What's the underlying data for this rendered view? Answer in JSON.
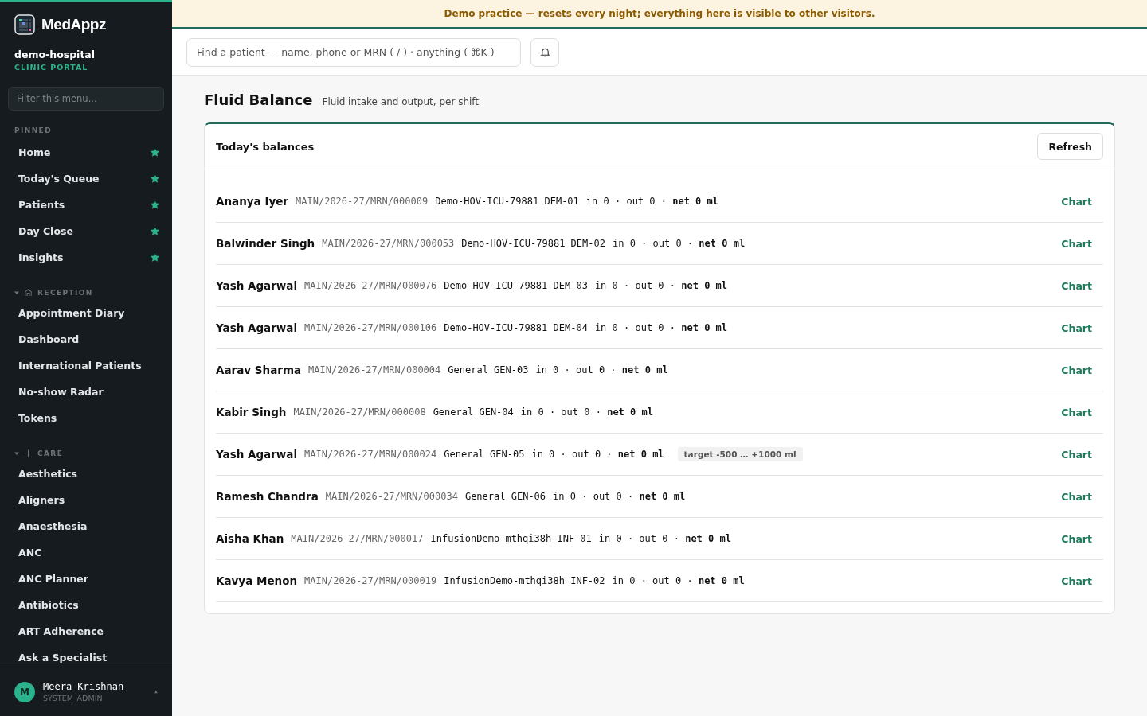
{
  "brand": {
    "name": "MedAppz",
    "org": "demo-hospital",
    "portal": "CLINIC PORTAL"
  },
  "sidebar": {
    "filter_placeholder": "Filter this menu...",
    "pinned": {
      "title": "PINNED",
      "items": [
        {
          "label": "Home",
          "starred": true
        },
        {
          "label": "Today's Queue",
          "starred": true
        },
        {
          "label": "Patients",
          "starred": true
        },
        {
          "label": "Day Close",
          "starred": true
        },
        {
          "label": "Insights",
          "starred": true
        }
      ]
    },
    "sections": [
      {
        "title": "RECEPTION",
        "kind": "home",
        "expanded": true,
        "items": [
          "Appointment Diary",
          "Dashboard",
          "International Patients",
          "No-show Radar",
          "Tokens"
        ]
      },
      {
        "title": "CARE",
        "kind": "plus",
        "expanded": true,
        "items": [
          "Aesthetics",
          "Aligners",
          "Anaesthesia",
          "ANC",
          "ANC Planner",
          "Antibiotics",
          "ART Adherence",
          "Ask a Specialist"
        ]
      }
    ],
    "user": {
      "initial": "M",
      "name": "Meera Krishnan",
      "role": "SYSTEM_ADMIN"
    }
  },
  "banner": "Demo practice — resets every night; everything here is visible to other visitors.",
  "search": {
    "placeholder": "Find a patient — name, phone or MRN ( / ) · anything ( ⌘K )"
  },
  "page": {
    "title": "Fluid Balance",
    "subtitle": "Fluid intake and output, per shift"
  },
  "card": {
    "title": "Today's balances",
    "button": "Refresh",
    "rows": [
      {
        "name": "Ananya Iyer",
        "mrn": "MAIN/2026-27/MRN/000009",
        "location": "Demo-HOV-ICU-79881 DEM-01",
        "balance": "in 0 · out 0 · **net 0 ml**",
        "action": "Chart"
      },
      {
        "name": "Balwinder Singh",
        "mrn": "MAIN/2026-27/MRN/000053",
        "location": "Demo-HOV-ICU-79881 DEM-02",
        "balance": "in 0 · out 0 · **net 0 ml**",
        "action": "Chart"
      },
      {
        "name": "Yash Agarwal",
        "mrn": "MAIN/2026-27/MRN/000076",
        "location": "Demo-HOV-ICU-79881 DEM-03",
        "balance": "in 0 · out 0 · **net 0 ml**",
        "action": "Chart"
      },
      {
        "name": "Yash Agarwal",
        "mrn": "MAIN/2026-27/MRN/000106",
        "location": "Demo-HOV-ICU-79881 DEM-04",
        "balance": "in 0 · out 0 · **net 0 ml**",
        "action": "Chart"
      },
      {
        "name": "Aarav Sharma",
        "mrn": "MAIN/2026-27/MRN/000004",
        "location": "General GEN-03",
        "balance": "in 0 · out 0 · **net 0 ml**",
        "action": "Chart"
      },
      {
        "name": "Kabir Singh",
        "mrn": "MAIN/2026-27/MRN/000008",
        "location": "General GEN-04",
        "balance": "in 0 · out 0 · **net 0 ml**",
        "action": "Chart"
      },
      {
        "name": "Yash Agarwal",
        "mrn": "MAIN/2026-27/MRN/000024",
        "location": "General GEN-05",
        "balance": "in 0 · out 0 · **net 0 ml**",
        "target": "target -500 … +1000 ml",
        "action": "Chart"
      },
      {
        "name": "Ramesh Chandra",
        "mrn": "MAIN/2026-27/MRN/000034",
        "location": "General GEN-06",
        "balance": "in 0 · out 0 · **net 0 ml**",
        "action": "Chart"
      },
      {
        "name": "Aisha Khan",
        "mrn": "MAIN/2026-27/MRN/000017",
        "location": "InfusionDemo-mthqi38h INF-01",
        "balance": "in 0 · out 0 · **net 0 ml**",
        "action": "Chart"
      },
      {
        "name": "Kavya Menon",
        "mrn": "MAIN/2026-27/MRN/000019",
        "location": "InfusionDemo-mthqi38h INF-02",
        "balance": "in 0 · out 0 · **net 0 ml**",
        "action": "Chart"
      }
    ]
  }
}
